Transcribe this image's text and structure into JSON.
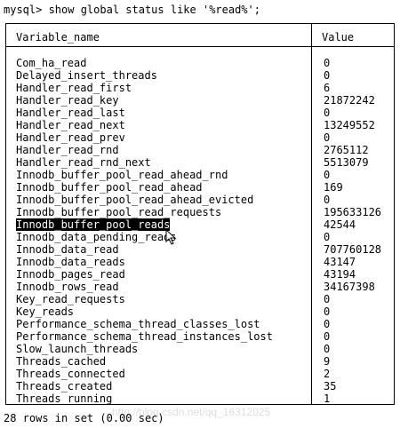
{
  "command": "mysql> show global status like '%read%';",
  "table": {
    "headers": [
      "Variable_name",
      "Value"
    ],
    "rows": [
      {
        "name": "Com_ha_read",
        "value": "0"
      },
      {
        "name": "Delayed_insert_threads",
        "value": "0"
      },
      {
        "name": "Handler_read_first",
        "value": "6"
      },
      {
        "name": "Handler_read_key",
        "value": "21872242"
      },
      {
        "name": "Handler_read_last",
        "value": "0"
      },
      {
        "name": "Handler_read_next",
        "value": "13249552"
      },
      {
        "name": "Handler_read_prev",
        "value": "0"
      },
      {
        "name": "Handler_read_rnd",
        "value": "2765112"
      },
      {
        "name": "Handler_read_rnd_next",
        "value": "5513079"
      },
      {
        "name": "Innodb_buffer_pool_read_ahead_rnd",
        "value": "0"
      },
      {
        "name": "Innodb_buffer_pool_read_ahead",
        "value": "169"
      },
      {
        "name": "Innodb_buffer_pool_read_ahead_evicted",
        "value": "0"
      },
      {
        "name": "Innodb_buffer_pool_read_requests",
        "value": "195633126"
      },
      {
        "name": "Innodb_buffer_pool_reads",
        "value": "42544"
      },
      {
        "name": "Innodb_data_pending_reads",
        "value": "0"
      },
      {
        "name": "Innodb_data_read",
        "value": "707760128"
      },
      {
        "name": "Innodb_data_reads",
        "value": "43147"
      },
      {
        "name": "Innodb_pages_read",
        "value": "43194"
      },
      {
        "name": "Innodb_rows_read",
        "value": "34167398"
      },
      {
        "name": "Key_read_requests",
        "value": "0"
      },
      {
        "name": "Key_reads",
        "value": "0"
      },
      {
        "name": "Performance_schema_thread_classes_lost",
        "value": "0"
      },
      {
        "name": "Performance_schema_thread_instances_lost",
        "value": "0"
      },
      {
        "name": "Slow_launch_threads",
        "value": "0"
      },
      {
        "name": "Threads_cached",
        "value": "9"
      },
      {
        "name": "Threads_connected",
        "value": "2"
      },
      {
        "name": "Threads_created",
        "value": "35"
      },
      {
        "name": "Threads_running",
        "value": "1"
      }
    ]
  },
  "selected_row": "Innodb_buffer_pool_reads",
  "footer": "28 rows in set (0.00 sec)",
  "watermark": "http://blog.csdn.net/qq_16312025"
}
